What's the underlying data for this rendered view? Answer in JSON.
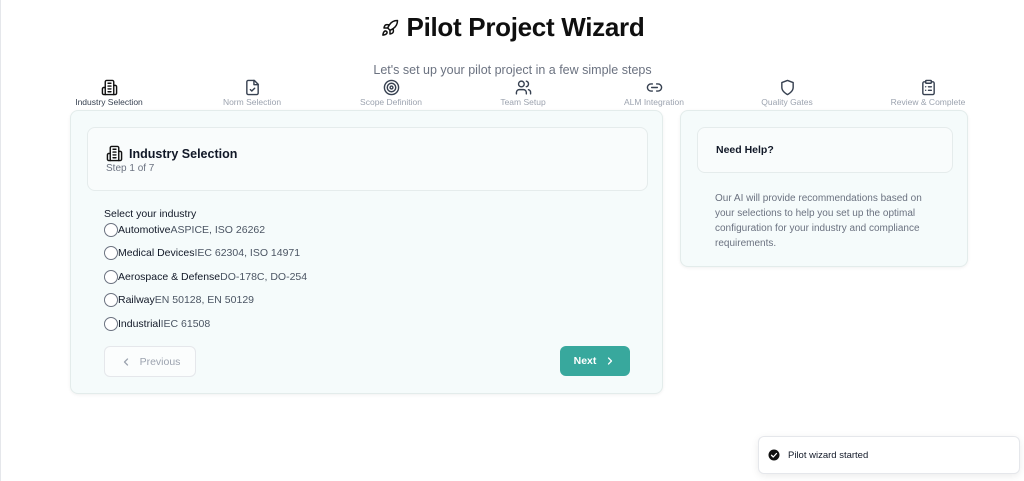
{
  "header": {
    "title": "Pilot Project Wizard",
    "subtitle": "Let's set up your pilot project in a few simple steps"
  },
  "steps": [
    {
      "label": "Industry Selection",
      "icon": "building-icon",
      "active": true
    },
    {
      "label": "Norm Selection",
      "icon": "file-check-icon"
    },
    {
      "label": "Scope Definition",
      "icon": "target-icon"
    },
    {
      "label": "Team Setup",
      "icon": "users-icon"
    },
    {
      "label": "ALM Integration",
      "icon": "link-icon"
    },
    {
      "label": "Quality Gates",
      "icon": "shield-icon"
    },
    {
      "label": "Review & Complete",
      "icon": "clipboard-icon"
    }
  ],
  "step_card": {
    "title": "Industry Selection",
    "subtitle": "Step 1 of 7",
    "select_label": "Select your industry",
    "options": [
      {
        "name": "Automotive",
        "desc": "ASPICE, ISO 26262"
      },
      {
        "name": "Medical Devices",
        "desc": "IEC 62304, ISO 14971"
      },
      {
        "name": "Aerospace & Defense",
        "desc": "DO-178C, DO-254"
      },
      {
        "name": "Railway",
        "desc": "EN 50128, EN 50129"
      },
      {
        "name": "Industrial",
        "desc": "IEC 61508"
      }
    ],
    "prev_label": "Previous",
    "next_label": "Next"
  },
  "help": {
    "title": "Need Help?",
    "text": "Our AI will provide recommendations based on your selections to help you set up the optimal configuration for your industry and compliance requirements."
  },
  "toast": {
    "text": "Pilot wizard started"
  },
  "colors": {
    "accent": "#38a89d",
    "card_bg": "#f5fbfb",
    "muted_text": "#6b7280"
  }
}
